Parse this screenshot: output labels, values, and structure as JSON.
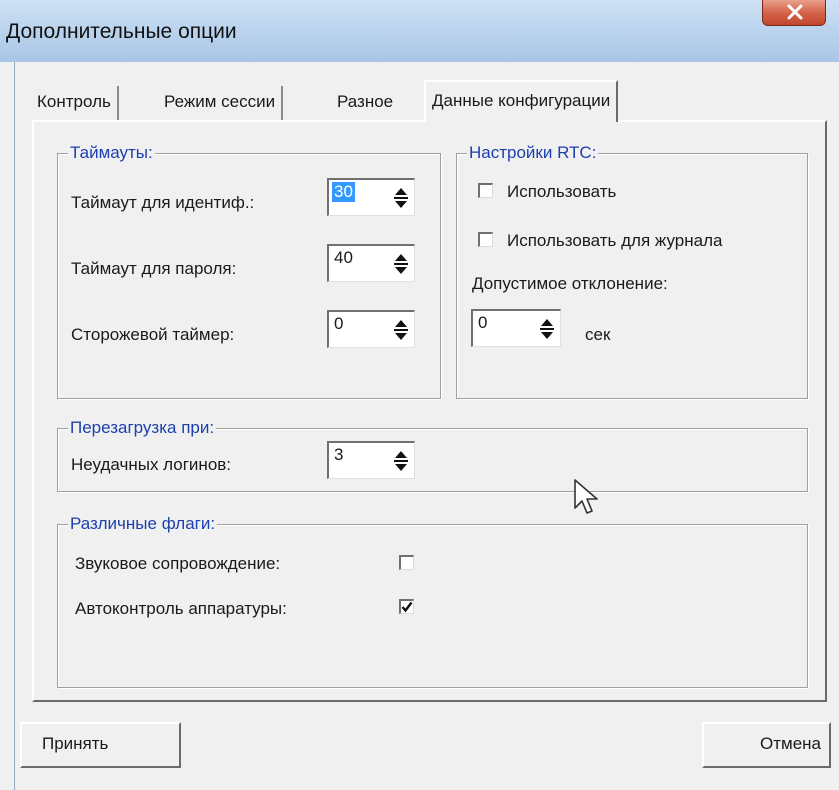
{
  "window": {
    "title": "Дополнительные опции",
    "close_icon": "close-x-icon"
  },
  "tabs": [
    {
      "label": "Контроль",
      "active": false
    },
    {
      "label": "Режим сессии",
      "active": false
    },
    {
      "label": "Разное",
      "active": false
    },
    {
      "label": "Данные конфигурации",
      "active": true
    }
  ],
  "timeouts": {
    "title": "Таймауты:",
    "ident_label": "Таймаут для идентиф.:",
    "ident_value": "30",
    "password_label": "Таймаут для пароля:",
    "password_value": "40",
    "watchdog_label": "Сторожевой таймер:",
    "watchdog_value": "0"
  },
  "rtc": {
    "title": "Настройки RTC:",
    "use_label": "Использовать",
    "use_checked": false,
    "use_journal_label": "Использовать для журнала",
    "use_journal_checked": false,
    "tolerance_label": "Допустимое отклонение:",
    "tolerance_value": "0",
    "tolerance_unit": "сек"
  },
  "reboot": {
    "title": "Перезагрузка при:",
    "failed_logins_label": "Неудачных логинов:",
    "failed_logins_value": "3"
  },
  "flags": {
    "title": "Различные флаги:",
    "sound_label": "Звуковое сопровождение:",
    "sound_checked": false,
    "autocontrol_label": "Автоконтроль аппаратуры:",
    "autocontrol_checked": true
  },
  "buttons": {
    "accept": "Принять",
    "cancel": "Отмена"
  },
  "colors": {
    "group_title": "#1c3fae",
    "selection": "#3399ff",
    "titlebar": "#bcd4ee",
    "close_button": "#c2452e"
  }
}
